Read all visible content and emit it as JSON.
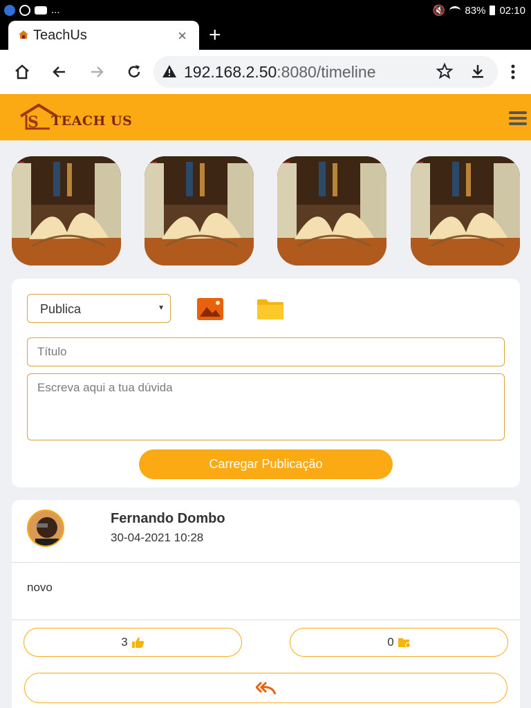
{
  "statusbar": {
    "battery": "83%",
    "time": "02:10",
    "overflow": "..."
  },
  "browser": {
    "tab_title": "TeachUs",
    "tab_close": "×",
    "new_tab": "+",
    "url_host": "192.168.2.50",
    "url_rest": ":8080/timeline"
  },
  "app": {
    "logo_text": "TEACH US",
    "brand_color": "#fbaa13"
  },
  "composer": {
    "visibility_value": "Publica",
    "title_placeholder": "Título",
    "body_placeholder": "Escreva aqui a tua dúvida",
    "submit_label": "Carregar Publicação"
  },
  "post": {
    "author": "Fernando Dombo",
    "date": "30-04-2021 10:28",
    "text": "novo",
    "likes": "3",
    "saves": "0"
  }
}
